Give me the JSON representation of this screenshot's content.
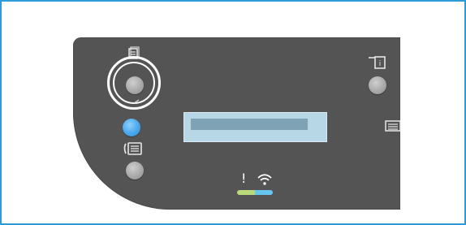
{
  "screen": {
    "border_color": "#2f9bd6",
    "panel_color": "#545454"
  },
  "control_panel": {
    "copy_icon": "copy-icon",
    "fax_icon": "fax-icon",
    "info_icon": "info-icon",
    "menu_icon": "menu-icon",
    "status": {
      "alert_text": "!",
      "wifi_icon": "wifi-icon"
    },
    "lcd": {
      "color": "#b8d7e6",
      "bar_color": "#7fa3b5"
    }
  }
}
